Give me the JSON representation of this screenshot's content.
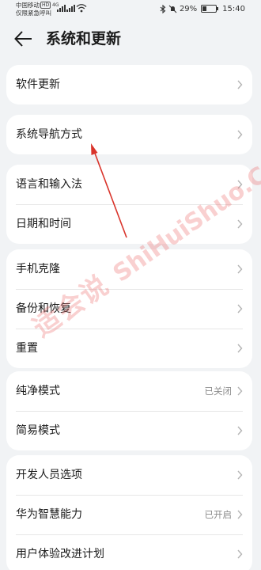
{
  "status_bar": {
    "carrier_line1": "中国移动",
    "carrier_hd": "HD",
    "carrier_line2": "仅限紧急呼叫",
    "network": "4G",
    "battery_percent": "29%",
    "battery_level": 0.29,
    "time": "15:40",
    "icons": [
      "signal-icon",
      "wifi-icon",
      "bluetooth-icon",
      "mute-icon",
      "battery-icon"
    ]
  },
  "header": {
    "back_icon": "arrow-left-icon",
    "title": "系统和更新"
  },
  "groups": [
    {
      "items": [
        {
          "label": "软件更新"
        }
      ]
    },
    {
      "items": [
        {
          "label": "系统导航方式"
        }
      ]
    },
    {
      "items": [
        {
          "label": "语言和输入法"
        },
        {
          "label": "日期和时间"
        }
      ]
    },
    {
      "items": [
        {
          "label": "手机克隆"
        },
        {
          "label": "备份和恢复"
        },
        {
          "label": "重置"
        }
      ]
    },
    {
      "items": [
        {
          "label": "纯净模式",
          "value": "已关闭"
        },
        {
          "label": "简易模式"
        }
      ]
    },
    {
      "items": [
        {
          "label": "开发人员选项"
        },
        {
          "label": "华为智慧能力",
          "value": "已开启"
        },
        {
          "label": "用户体验改进计划"
        }
      ]
    }
  ],
  "watermark": {
    "cn": "适会说",
    "en": "ShiHuiShuo.Com"
  },
  "colors": {
    "background": "#f1f3f5",
    "card": "#ffffff",
    "text": "#1a1a1a",
    "secondary_text": "#8c8c8c",
    "watermark": "#e85656",
    "annotation_arrow": "#d9342b"
  }
}
